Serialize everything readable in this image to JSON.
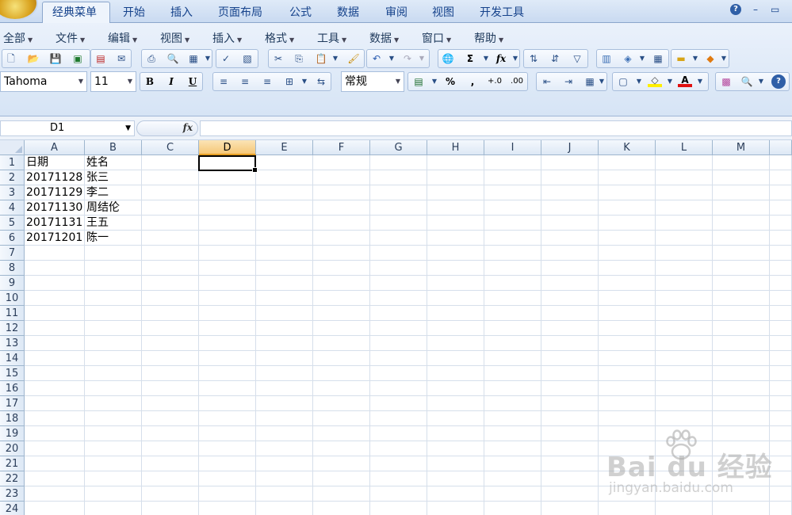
{
  "ribbon_tabs": [
    "经典菜单",
    "开始",
    "插入",
    "页面布局",
    "公式",
    "数据",
    "审阅",
    "视图",
    "开发工具"
  ],
  "active_tab": "经典菜单",
  "window_controls": {
    "help": "?",
    "minimize": "–",
    "restore": "▭"
  },
  "classic_menus": [
    "全部",
    "文件",
    "编辑",
    "视图",
    "插入",
    "格式",
    "工具",
    "数据",
    "窗口",
    "帮助"
  ],
  "format_bar": {
    "font_name": "Tahoma",
    "font_size": "11",
    "bold": "B",
    "italic": "I",
    "underline": "U",
    "number_format": "常规",
    "percent": "%",
    "comma": ",",
    "sigma": "Σ",
    "fx": "fx"
  },
  "formula_bar": {
    "name_box": "D1",
    "fx_label": "fx",
    "formula": ""
  },
  "columns": [
    "A",
    "B",
    "C",
    "D",
    "E",
    "F",
    "G",
    "H",
    "I",
    "J",
    "K",
    "L",
    "M"
  ],
  "selected_column": "D",
  "rows": [
    "1",
    "2",
    "3",
    "4",
    "5",
    "6",
    "7",
    "8",
    "9",
    "10",
    "11",
    "12",
    "13",
    "14",
    "15",
    "16",
    "17",
    "18",
    "19",
    "20",
    "21",
    "22",
    "23",
    "24"
  ],
  "cells": [
    [
      "日期",
      "姓名"
    ],
    [
      "20171128",
      "张三"
    ],
    [
      "20171129",
      "李二"
    ],
    [
      "20171130",
      "周结伦"
    ],
    [
      "20171131",
      "王五"
    ],
    [
      "20171201",
      "陈一"
    ]
  ],
  "watermark": {
    "brand": "Bai du 经验",
    "url": "jingyan.baidu.com"
  }
}
